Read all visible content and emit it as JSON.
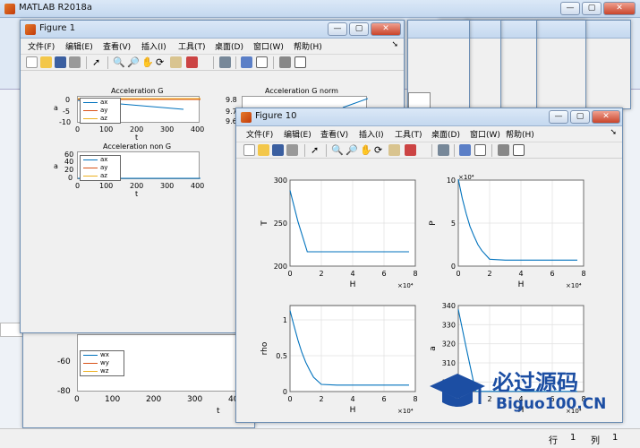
{
  "main_window": {
    "title": "MATLAB R2018a"
  },
  "menus": [
    "文件(F)",
    "编辑(E)",
    "查看(V)",
    "插入(I)",
    "工具(T)",
    "桌面(D)",
    "窗口(W)",
    "帮助(H)"
  ],
  "figure1": {
    "title": "Figure 1",
    "axes_accel_g": {
      "title": "Acceleration G",
      "ylabel": "a",
      "xlabel": "t",
      "yticks": [
        "0",
        "-5",
        "-10"
      ],
      "xticks": [
        "0",
        "100",
        "200",
        "300",
        "400"
      ],
      "legend": [
        "ax",
        "ay",
        "az"
      ]
    },
    "axes_accel_g_norm": {
      "title": "Acceleration G norm",
      "yticks": [
        "9.8",
        "9.7",
        "9.6"
      ]
    },
    "axes_accel_non_g": {
      "title": "Acceleration non G",
      "ylabel": "a",
      "xlabel": "t",
      "yticks": [
        "60",
        "40",
        "20",
        "0"
      ],
      "xticks": [
        "0",
        "100",
        "200",
        "300",
        "400"
      ],
      "legend": [
        "ax",
        "ay",
        "az"
      ]
    }
  },
  "background_fig": {
    "yticks": [
      "-60",
      "-80"
    ],
    "xticks": [
      "0",
      "100",
      "200",
      "300",
      "400"
    ],
    "xlabel": "t",
    "legend": [
      "wx",
      "wy",
      "wz"
    ]
  },
  "figure10": {
    "title": "Figure 10",
    "chart_data": [
      {
        "type": "line",
        "xlabel": "H",
        "ylabel": "T",
        "x_exponent": "×10⁴",
        "xlim": [
          0,
          8
        ],
        "ylim": [
          200,
          300
        ],
        "xticks": [
          "0",
          "2",
          "4",
          "6",
          "8"
        ],
        "yticks": [
          "300",
          "250",
          "200"
        ],
        "x": [
          0,
          0.5,
          1.1,
          2,
          4,
          6,
          7.6
        ],
        "y": [
          288,
          252,
          216.65,
          216.65,
          216.65,
          216.65,
          216.65
        ]
      },
      {
        "type": "line",
        "xlabel": "H",
        "ylabel": "P",
        "x_exponent": "×10⁴",
        "y_exponent": "×10⁴",
        "xlim": [
          0,
          8
        ],
        "ylim": [
          0,
          10
        ],
        "xticks": [
          "0",
          "2",
          "4",
          "6",
          "8"
        ],
        "yticks": [
          "10",
          "5",
          "0"
        ],
        "x": [
          0,
          0.25,
          0.5,
          0.75,
          1,
          1.25,
          1.5,
          2,
          3,
          5,
          7.6
        ],
        "y": [
          10.1,
          7.9,
          6.1,
          4.6,
          3.5,
          2.5,
          1.8,
          0.8,
          0.7,
          0.7,
          0.7
        ]
      },
      {
        "type": "line",
        "xlabel": "H",
        "ylabel": "rho",
        "x_exponent": "×10⁴",
        "xlim": [
          0,
          8
        ],
        "ylim": [
          0,
          1.2
        ],
        "xticks": [
          "0",
          "2",
          "4",
          "6",
          "8"
        ],
        "yticks": [
          "1",
          "0.5",
          "0"
        ],
        "x": [
          0,
          0.25,
          0.5,
          0.75,
          1,
          1.25,
          1.5,
          2,
          3,
          5,
          7.6
        ],
        "y": [
          1.13,
          0.92,
          0.72,
          0.55,
          0.41,
          0.3,
          0.2,
          0.1,
          0.09,
          0.09,
          0.09
        ]
      },
      {
        "type": "line",
        "xlabel": "H",
        "ylabel": "a",
        "x_exponent": "×10⁴",
        "xlim": [
          0,
          8
        ],
        "ylim": [
          295,
          340
        ],
        "xticks": [
          "0",
          "2",
          "4",
          "6",
          "8"
        ],
        "yticks": [
          "340",
          "330",
          "320",
          "310",
          "300"
        ],
        "x": [
          0,
          0.5,
          1.1,
          2,
          4,
          6,
          7.6
        ],
        "y": [
          338,
          318,
          295.1,
          295.1,
          295.1,
          295.1,
          295.1
        ]
      }
    ]
  },
  "watermark": {
    "chinese": "必过源码",
    "site": "Biguo100.CN"
  },
  "statusbar": {
    "row_label": "行",
    "row_value": "1",
    "col_label": "列",
    "col_value": "1"
  }
}
